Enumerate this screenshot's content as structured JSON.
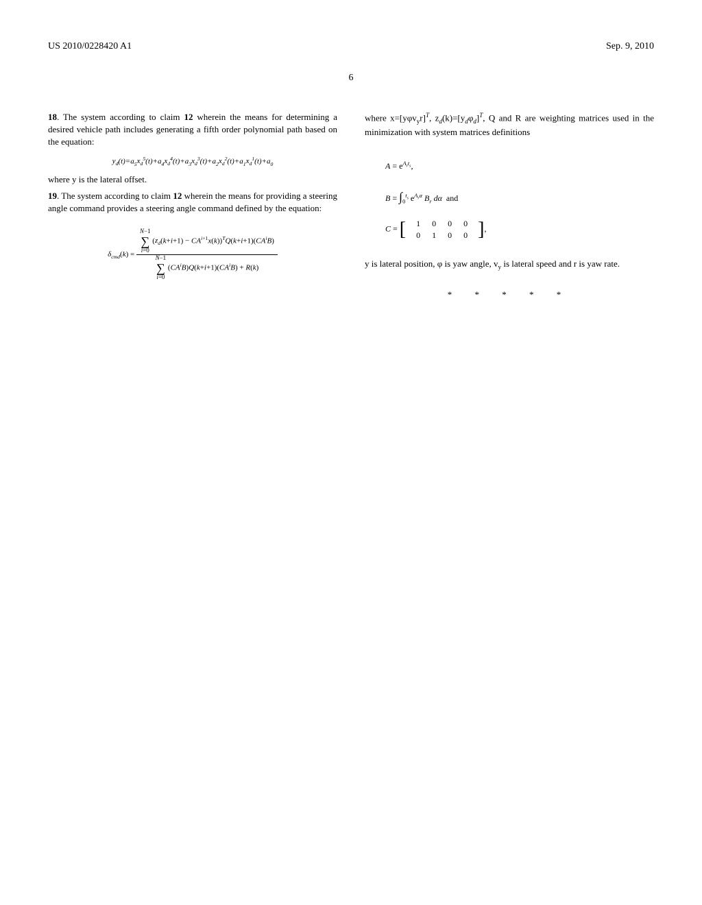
{
  "header": {
    "publication_number": "US 2010/0228420 A1",
    "date": "Sep. 9, 2010"
  },
  "page_number": "6",
  "left_column": {
    "claim_18": {
      "number": "18",
      "text": ". The system according to claim ",
      "ref": "12",
      "text2": " wherein the means for determining a desired vehicle path includes generating a fifth order polynomial path based on the equation:",
      "formula": "y_d(t)=a_5x_d^5(t)+a_4x_d^4(t)+a_3x_d^3(t)+a_2x_d^2(t)+a_1x_d^1(t)+a_0",
      "where": "where y is the lateral offset."
    },
    "claim_19": {
      "number": "19",
      "text": ". The system according to claim ",
      "ref": "12",
      "text2": " wherein the means for providing a steering angle command provides a steering angle command defined by the equation:",
      "delta_cmd": "δ_cmd(k) =",
      "numerator": "Σ_{i=0}^{N-1} (z_d(k+i+1) - CA^{i+1}x(k))^T Q(k+i+1)(CA^i B)",
      "denominator": "Σ_{i=0}^{N-1} (CA^i B)Q(k+i+1)(CA^i B) + R(k)"
    }
  },
  "right_column": {
    "where_text_1": "where x=[yφv_y r]^T, z_d(k)=[y_d φ_d]^T, Q and R are weighting matrices used in the minimization with system matrices definitions",
    "matrix_defs": {
      "a_def": "A = e^{A_r t_s},",
      "b_def_pre": "B = ∫_0^{t_s} e^{A_r α} B_r dα  and",
      "c_def": "C ="
    },
    "final_text": "y is lateral position, φ is yaw angle, v_y is lateral speed and r is yaw rate.",
    "end_marker": "* * * * *"
  }
}
